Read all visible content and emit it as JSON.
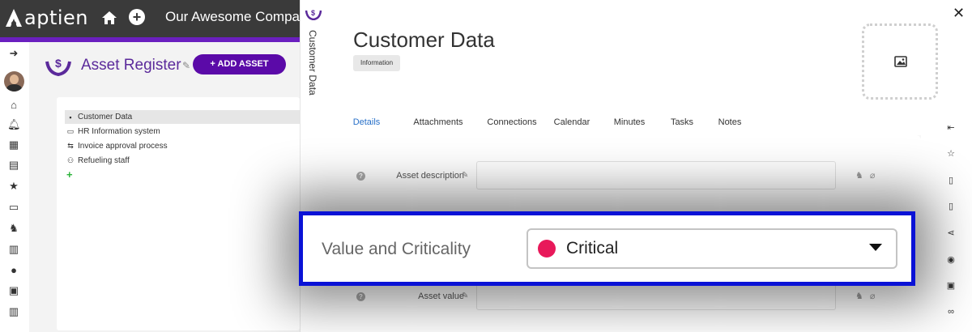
{
  "app": {
    "logo_text": "aptien",
    "company_name": "Our Awesome Company"
  },
  "register": {
    "title": "Asset Register",
    "add_button_label": "+ ADD ASSET"
  },
  "tree": {
    "items": [
      {
        "label": "Customer Data",
        "icon": "info-square-icon",
        "selected": true
      },
      {
        "label": "HR Information system",
        "icon": "monitor-icon",
        "selected": false
      },
      {
        "label": "Invoice approval process",
        "icon": "process-icon",
        "selected": false
      },
      {
        "label": "Refueling staff",
        "icon": "people-icon",
        "selected": false
      }
    ]
  },
  "side_strip": {
    "label": "Customer Data"
  },
  "panel": {
    "title": "Customer Data",
    "badge": "Information",
    "tabs": [
      {
        "label": "Details",
        "active": true
      },
      {
        "label": "Attachments",
        "active": false
      },
      {
        "label": "Connections",
        "active": false
      },
      {
        "label": "Calendar",
        "active": false
      },
      {
        "label": "Minutes",
        "active": false
      },
      {
        "label": "Tasks",
        "active": false
      },
      {
        "label": "Notes",
        "active": false
      }
    ],
    "fields": {
      "asset_description": {
        "label": "Asset description",
        "value": ""
      },
      "asset_value": {
        "label": "Asset value",
        "value": ""
      }
    }
  },
  "highlight": {
    "label": "Value and Criticality",
    "selected_value": "Critical",
    "dot_color": "#e8195a"
  },
  "colors": {
    "accent_purple": "#5b0aa8",
    "highlight_border": "#0a12d6",
    "link_blue": "#2870c8"
  }
}
